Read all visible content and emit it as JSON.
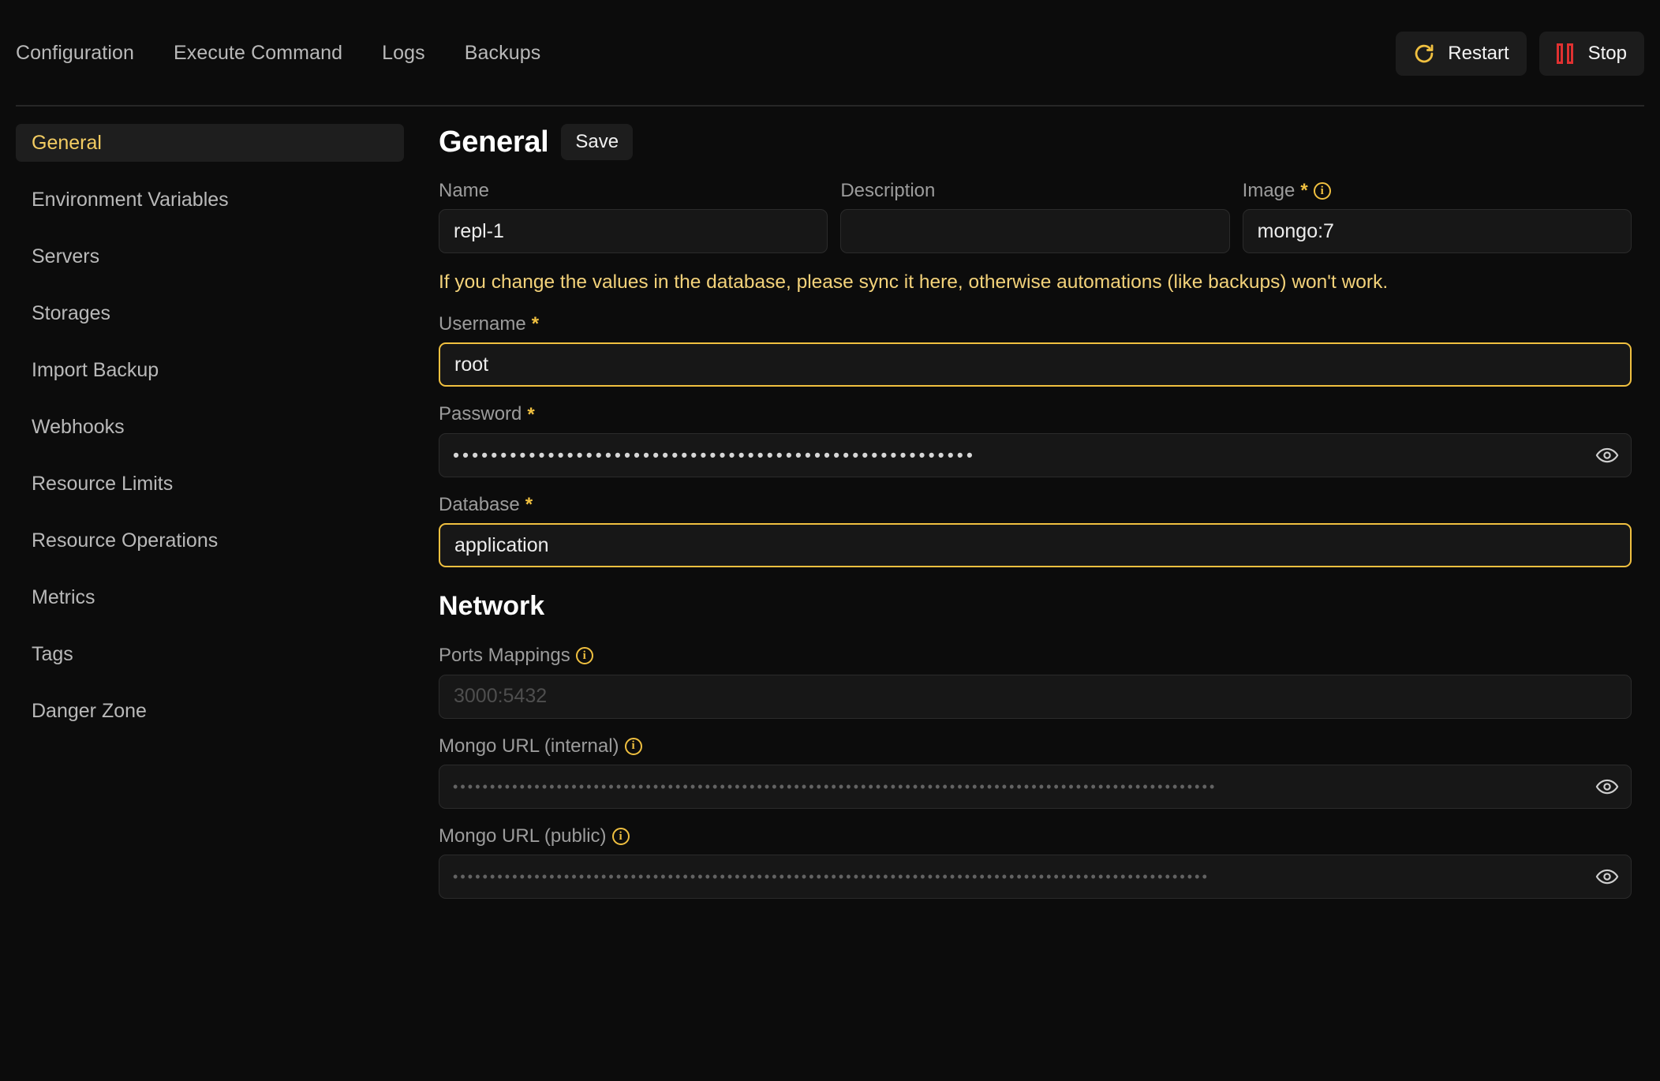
{
  "topbar": {
    "tabs": [
      {
        "label": "Configuration"
      },
      {
        "label": "Execute Command"
      },
      {
        "label": "Logs"
      },
      {
        "label": "Backups"
      }
    ],
    "actions": {
      "restart_label": "Restart",
      "restart_icon": "rotate-cw-icon",
      "restart_icon_color": "#f0c040",
      "stop_label": "Stop",
      "stop_icon": "pause-icon",
      "stop_icon_color": "#e03131"
    }
  },
  "sidebar": {
    "items": [
      {
        "label": "General",
        "active": true
      },
      {
        "label": "Environment Variables",
        "active": false
      },
      {
        "label": "Servers",
        "active": false
      },
      {
        "label": "Storages",
        "active": false
      },
      {
        "label": "Import Backup",
        "active": false
      },
      {
        "label": "Webhooks",
        "active": false
      },
      {
        "label": "Resource Limits",
        "active": false
      },
      {
        "label": "Resource Operations",
        "active": false
      },
      {
        "label": "Metrics",
        "active": false
      },
      {
        "label": "Tags",
        "active": false
      },
      {
        "label": "Danger Zone",
        "active": false
      }
    ],
    "active_color": "#f3cc62"
  },
  "main": {
    "general": {
      "title": "General",
      "save_label": "Save",
      "name": {
        "label": "Name",
        "value": "repl-1",
        "placeholder": ""
      },
      "description": {
        "label": "Description",
        "value": "",
        "placeholder": ""
      },
      "image": {
        "label": "Image",
        "required_marker": "*",
        "info": "i",
        "value": "mongo:7",
        "placeholder": ""
      },
      "warning": "If you change the values in the database, please sync it here, otherwise automations (like backups) won't work.",
      "warning_color": "#f3d27a",
      "username": {
        "label": "Username",
        "required_marker": "*",
        "value": "root",
        "placeholder": "",
        "highlighted": true
      },
      "password": {
        "label": "Password",
        "required_marker": "*",
        "masked_value": "•••••••••••••••••••••••••••••••••••••••••••••••••••••••",
        "reveal_icon": "eye-icon"
      },
      "database": {
        "label": "Database",
        "required_marker": "*",
        "value": "application",
        "placeholder": "",
        "highlighted": true
      }
    },
    "network": {
      "title": "Network",
      "ports_mappings": {
        "label": "Ports Mappings",
        "info": "i",
        "value": "",
        "placeholder": "3000:5432"
      },
      "mongo_url_internal": {
        "label": "Mongo URL (internal)",
        "info": "i",
        "masked_value": "•••••••••••••••••••••••••••••••••••••••••••••••••••••••••••••••••••••••••••••••••••••••••••••••••••••••",
        "reveal_icon": "eye-icon"
      },
      "mongo_url_public": {
        "label": "Mongo URL (public)",
        "info": "i",
        "masked_value": "••••••••••••••••••••••••••••••••••••••••••••••••••••••••••••••••••••••••••••••••••••••••••••••••••••••",
        "reveal_icon": "eye-icon"
      }
    }
  }
}
